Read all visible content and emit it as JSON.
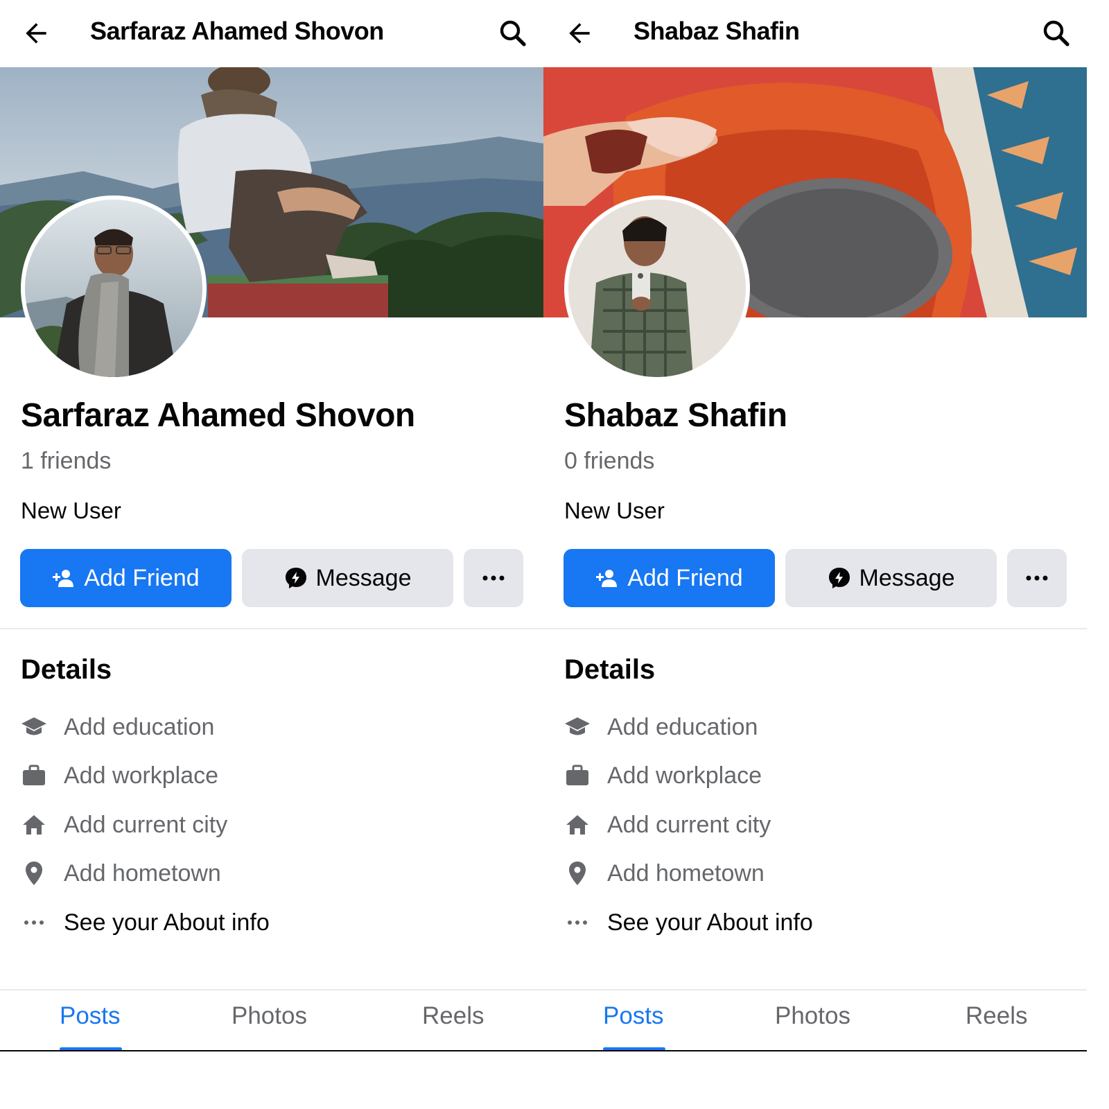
{
  "profiles": [
    {
      "header_title": "Sarfaraz Ahamed Shovon",
      "name": "Sarfaraz Ahamed Shovon",
      "friends": "1 friends",
      "bio": "New User",
      "cover_description_icon": "cover-photo-mountains",
      "avatar_icon": "profile-photo-man-scarf"
    },
    {
      "header_title": "Shabaz Shafin",
      "name": "Shabaz Shafin",
      "friends": "0 friends",
      "bio": "New User",
      "cover_description_icon": "cover-photo-tea-cup",
      "avatar_icon": "profile-photo-selfie"
    }
  ],
  "buttons": {
    "add_friend": "Add Friend",
    "message": "Message"
  },
  "details": {
    "title": "Details",
    "items": [
      {
        "label": "Add education",
        "icon": "education-icon"
      },
      {
        "label": "Add workplace",
        "icon": "briefcase-icon"
      },
      {
        "label": "Add current city",
        "icon": "home-icon"
      },
      {
        "label": "Add hometown",
        "icon": "location-pin-icon"
      },
      {
        "label": "See your About info",
        "icon": "more-dots-icon"
      }
    ]
  },
  "tabs": [
    "Posts",
    "Photos",
    "Reels"
  ],
  "active_tab": "Posts",
  "colors": {
    "primary": "#1877f2",
    "secondary_text": "#65676b",
    "button_gray": "#e4e6eb"
  }
}
